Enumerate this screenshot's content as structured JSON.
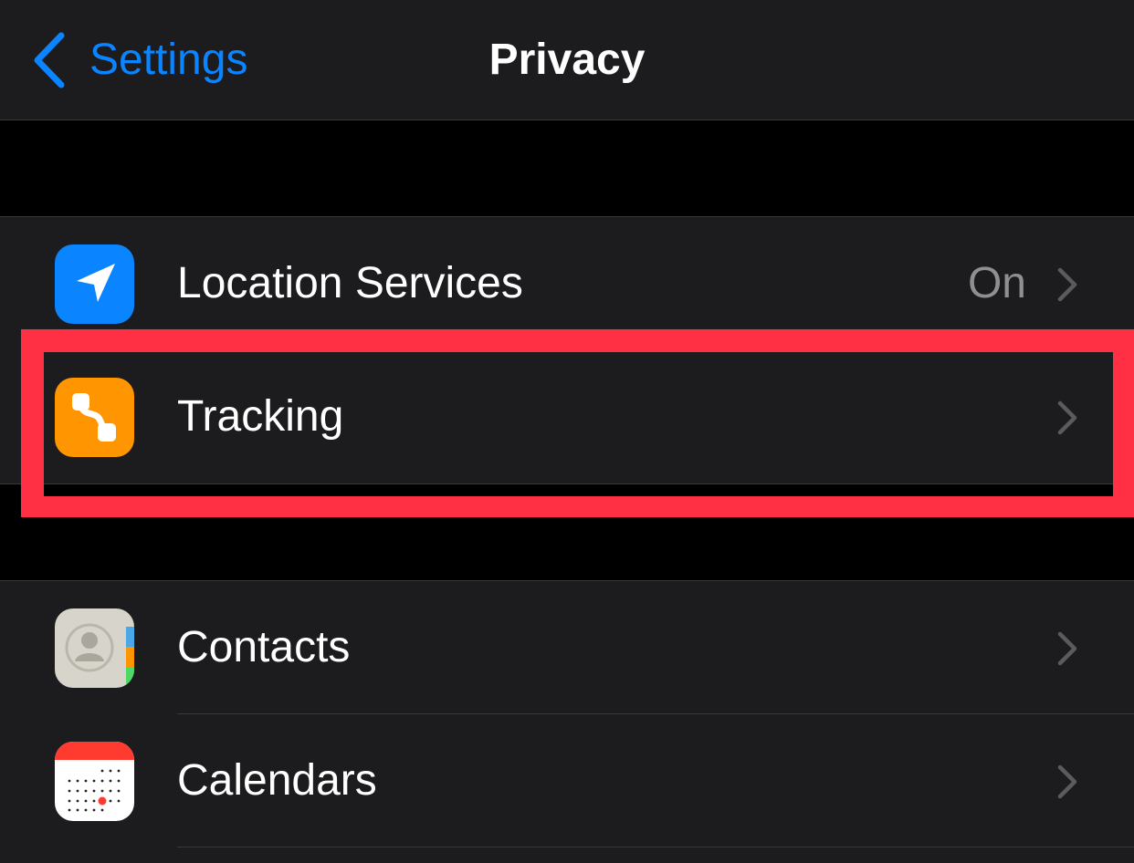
{
  "navbar": {
    "back_label": "Settings",
    "title": "Privacy"
  },
  "groups": [
    {
      "items": [
        {
          "label": "Location Services",
          "value": "On",
          "icon": "location-arrow-icon",
          "icon_color": "#0a84ff"
        },
        {
          "label": "Tracking",
          "value": "",
          "icon": "tracking-icon",
          "icon_color": "#ff9500"
        }
      ]
    },
    {
      "items": [
        {
          "label": "Contacts",
          "icon": "contacts-icon",
          "icon_color": "#d7d5cb"
        },
        {
          "label": "Calendars",
          "icon": "calendar-icon",
          "icon_color": "#ffffff"
        }
      ]
    }
  ],
  "colors": {
    "accent": "#0a84ff",
    "highlight_box": "#ff3044",
    "background": "#000000",
    "cell": "#1c1c1e"
  }
}
